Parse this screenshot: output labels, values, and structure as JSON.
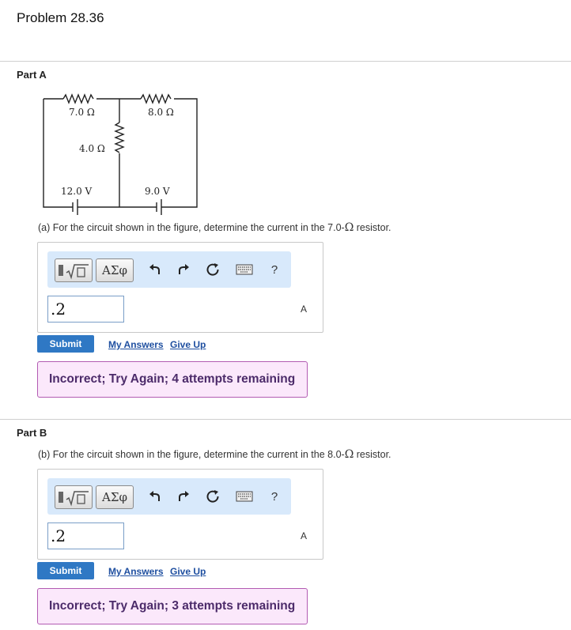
{
  "problem": {
    "title": "Problem 28.36"
  },
  "circuit": {
    "r1": "7.0 Ω",
    "r2": "8.0 Ω",
    "r3": "4.0 Ω",
    "emf1": "12.0 V",
    "emf2": "9.0 V"
  },
  "toolbar": {
    "templates_icon": "square-root-template-icon",
    "symbols_label": "ΑΣφ",
    "undo_icon": "undo-icon",
    "redo_icon": "redo-icon",
    "reset_icon": "reset-icon",
    "keyboard_icon": "keyboard-icon",
    "help_label": "?"
  },
  "parts": [
    {
      "label": "Part A",
      "question_pre": "(a) For the circuit shown in the figure, determine the current in the 7.0-",
      "omega": "Ω",
      "question_post": " resistor.",
      "answer_value": ".2",
      "unit": "A",
      "submit_label": "Submit",
      "my_answers_label": "My Answers",
      "give_up_label": "Give Up",
      "feedback": "Incorrect; Try Again; 4 attempts remaining"
    },
    {
      "label": "Part B",
      "question_pre": "(b) For the circuit shown in the figure, determine the current in the 8.0-",
      "omega": "Ω",
      "question_post": " resistor.",
      "answer_value": ".2",
      "unit": "A",
      "submit_label": "Submit",
      "my_answers_label": "My Answers",
      "give_up_label": "Give Up",
      "feedback": "Incorrect; Try Again; 3 attempts remaining"
    }
  ],
  "colors": {
    "submit": "#2f78c4",
    "toolbar_bg": "#d8e9fb",
    "feedback_bg": "#fbe8fb",
    "feedback_border": "#b25bb2",
    "feedback_text": "#4c2b6a"
  }
}
